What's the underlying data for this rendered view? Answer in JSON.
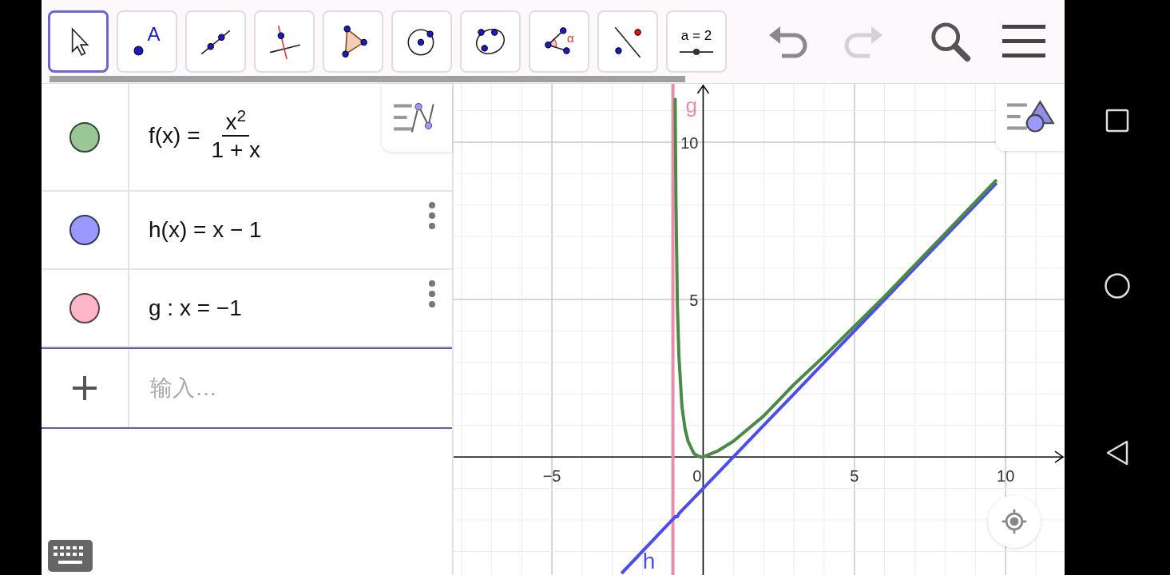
{
  "toolbar": {
    "tools": [
      {
        "kind": "move",
        "selected": true
      },
      {
        "kind": "point",
        "label": "A",
        "selected": false
      },
      {
        "kind": "line",
        "selected": false
      },
      {
        "kind": "perpendicular",
        "selected": false
      },
      {
        "kind": "polygon",
        "selected": false
      },
      {
        "kind": "circle",
        "selected": false
      },
      {
        "kind": "conic",
        "selected": false
      },
      {
        "kind": "angle",
        "label": "α",
        "selected": false
      },
      {
        "kind": "reflect",
        "selected": false
      },
      {
        "kind": "slider",
        "label": "a = 2",
        "selected": false
      }
    ],
    "undo": {
      "disabled": false
    },
    "redo": {
      "disabled": true
    }
  },
  "algebra": {
    "items": [
      {
        "kind": "fraction",
        "lhs": "f(x) =",
        "numerator": "x$^{2}$",
        "denominator": "1 + x",
        "color": "#99c795",
        "menu": false
      },
      {
        "kind": "plain",
        "text": "h(x) = x − 1",
        "color": "#9999ff",
        "menu": true
      },
      {
        "kind": "plain",
        "text": "g : x = −1",
        "color": "#ffb6c8",
        "menu": true
      }
    ],
    "input": {
      "placeholder": "输入…"
    }
  },
  "graph": {
    "chart_data": {
      "type": "line",
      "xlim": [
        -8.25,
        11.95
      ],
      "ylim": [
        -3.75,
        11.85
      ],
      "xticks": [
        {
          "value": -5,
          "label": "−5"
        },
        0,
        5,
        10
      ],
      "yticks": [
        5,
        10
      ],
      "x": [
        -2.7,
        -0.925,
        -0.92,
        -0.9,
        -0.85,
        -0.8,
        -0.7,
        -0.6,
        -0.5,
        -0.4,
        -0.3,
        -0.2,
        -0.1,
        0,
        0.5,
        1,
        2,
        3,
        4,
        6,
        8,
        9.7
      ],
      "grid": true,
      "series": [
        {
          "color": "#4a8a46",
          "values": [
            null,
            11.4,
            10.6,
            8.1,
            4.8,
            3.2,
            1.6,
            0.9,
            0.5,
            0.3,
            0.1,
            0.05,
            0,
            0,
            0.2,
            0.5,
            1.3,
            2.3,
            3.2,
            5.1,
            7.1,
            8.8
          ]
        },
        {
          "name": "h",
          "color": "#4d4ded",
          "values": [
            -3.7,
            -1.9,
            -1.9,
            -1.9,
            -1.9,
            -1.8,
            -1.7,
            -1.6,
            -1.5,
            -1.4,
            -1.3,
            -1.2,
            -1.1,
            -1,
            -0.5,
            0,
            1,
            2,
            3,
            5,
            7,
            8.7
          ]
        }
      ],
      "ref_lines": [
        {
          "axis": "x",
          "value": -1,
          "label": "g",
          "color": "#f08aaa"
        }
      ]
    }
  }
}
